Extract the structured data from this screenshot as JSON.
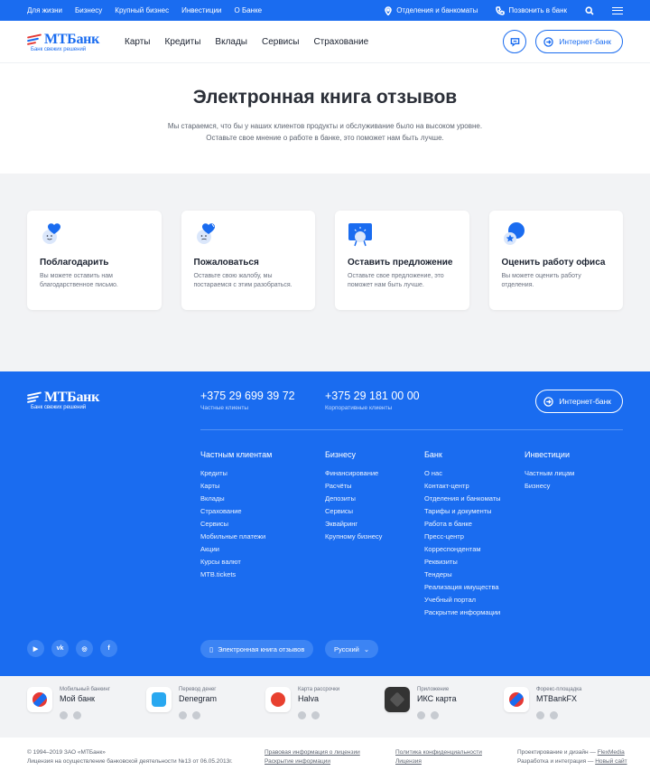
{
  "topbar": {
    "links": [
      "Для жизни",
      "Бизнесу",
      "Крупный бизнес",
      "Инвестиции",
      "О Банке"
    ],
    "branches": "Отделения и банкоматы",
    "call": "Позвонить в банк"
  },
  "brand": {
    "name": "МТБанк",
    "slogan": "Банк свежих решений"
  },
  "nav": [
    "Карты",
    "Кредиты",
    "Вклады",
    "Сервисы",
    "Страхование"
  ],
  "internet_bank": "Интернет-банк",
  "hero": {
    "title": "Электронная книга отзывов",
    "line1": "Мы стараемся, что бы у наших клиентов продукты и обслуживание было на высоком уровне.",
    "line2": "Оставьте свое мнение о работе в банке, это поможет нам быть лучше."
  },
  "cards": [
    {
      "title": "Поблагодарить",
      "text": "Вы можете оставить нам благодарственное письмо."
    },
    {
      "title": "Пожаловаться",
      "text": "Оставьте свою жалобу, мы постараемся с этим разобраться."
    },
    {
      "title": "Оставить предложение",
      "text": "Оставьте свое предложение, это поможет нам быть лучше."
    },
    {
      "title": "Оценить работу офиса",
      "text": "Вы можете оценить работу отделения."
    }
  ],
  "footer": {
    "phones": [
      {
        "number": "+375 29 699 39 72",
        "caption": "Частные клиенты"
      },
      {
        "number": "+375 29 181 00 00",
        "caption": "Корпоративные клиенты"
      }
    ],
    "columns": [
      {
        "title": "Частным клиентам",
        "items": [
          "Кредиты",
          "Карты",
          "Вклады",
          "Страхование",
          "Сервисы",
          "Мобильные платежи",
          "Акции",
          "Курсы валют",
          "MTB.tickets"
        ]
      },
      {
        "title": "Бизнесу",
        "items": [
          "Финансирование",
          "Расчёты",
          "Депозиты",
          "Сервисы",
          "Эквайринг",
          "Крупному бизнесу"
        ]
      },
      {
        "title": "Банк",
        "items": [
          "О нас",
          "Контакт-центр",
          "Отделения и банкоматы",
          "Тарифы и документы",
          "Работа в банке",
          "Пресс-центр",
          "Корреспондентам",
          "Реквизиты",
          "Тендеры",
          "Реализация имущества",
          "Учебный портал",
          "Раскрытие информации"
        ]
      },
      {
        "title": "Инвестиции",
        "items": [
          "Частным лицам",
          "Бизнесу"
        ]
      }
    ],
    "social": [
      "youtube-icon",
      "vk-icon",
      "instagram-icon",
      "facebook-icon"
    ],
    "feedback_book": "Электронная книга отзывов",
    "language": "Русский"
  },
  "apps": [
    {
      "caption": "Мобильный банкинг",
      "name": "Мой банк",
      "color": "#e53935"
    },
    {
      "caption": "Перевод денег",
      "name": "Denegram",
      "color": "#29a8f0"
    },
    {
      "caption": "Карта рассрочки",
      "name": "Halva",
      "color": "#e8402f"
    },
    {
      "caption": "Приложение",
      "name": "ИКС карта",
      "color": "#333333"
    },
    {
      "caption": "Форекс-площадка",
      "name": "MTBankFX",
      "color": "#e53935"
    }
  ],
  "legal": {
    "copyright": "© 1994–2019 ЗАО «МТБанк»",
    "license": "Лицензия на осуществление банковской деятельности №13 от 06.05.2013г.",
    "legal_info": "Правовая информация о лицензии",
    "disclosure": "Раскрытие информации",
    "privacy": "Политика конфиденциальности",
    "license_link": "Лицензия",
    "design_prefix": "Проектирование и дизайн —",
    "design_by": "FlexMedia",
    "dev_prefix": "Разработка и интеграция —",
    "dev_by": "Новый сайт"
  }
}
